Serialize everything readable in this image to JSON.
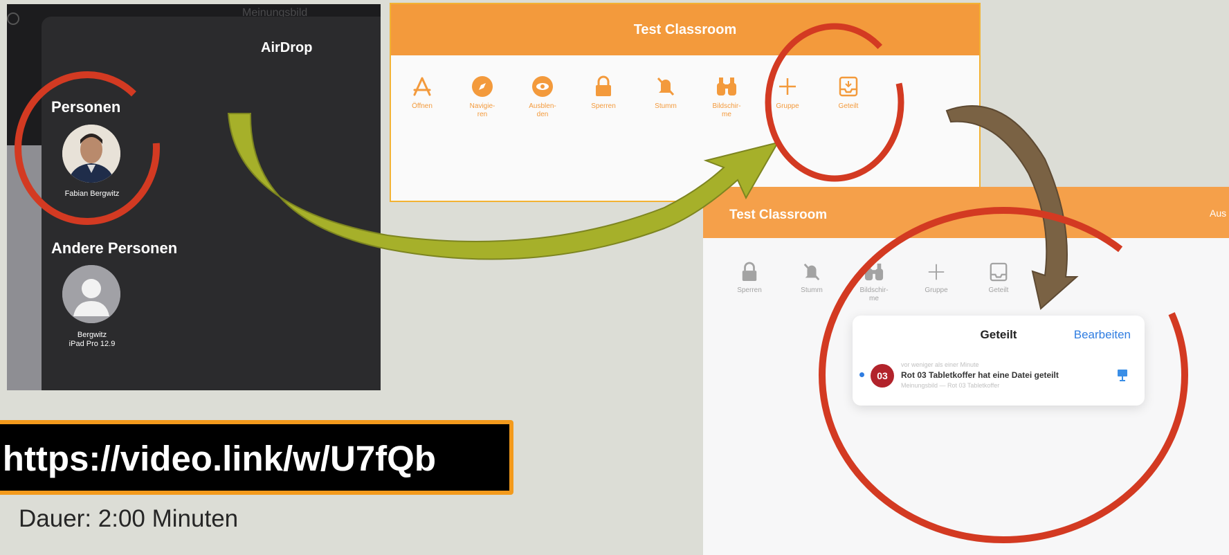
{
  "airdrop": {
    "top_title": "Meinungsbild",
    "title": "AirDrop",
    "section_people": "Personen",
    "person_name": "Fabian Bergwitz",
    "section_other": "Andere Personen",
    "device_name_line1": "Bergwitz",
    "device_name_line2": "iPad Pro 12.9"
  },
  "classroom_top": {
    "title": "Test Classroom",
    "toolbar": [
      {
        "label": "Öffnen",
        "icon": "app-store-icon"
      },
      {
        "label": "Navigie-\nren",
        "icon": "compass-icon"
      },
      {
        "label": "Ausblen-\nden",
        "icon": "eye-icon"
      },
      {
        "label": "Sperren",
        "icon": "lock-icon"
      },
      {
        "label": "Stumm",
        "icon": "mute-bell-icon"
      },
      {
        "label": "Bildschir-\nme",
        "icon": "binoculars-icon"
      },
      {
        "label": "Gruppe",
        "icon": "plus-icon"
      },
      {
        "label": "Geteilt",
        "icon": "tray-icon"
      }
    ]
  },
  "classroom_bottom": {
    "title": "Test Classroom",
    "right_label": "Aus",
    "toolbar": [
      {
        "label": "Sperren",
        "icon": "lock-icon"
      },
      {
        "label": "Stumm",
        "icon": "mute-bell-icon"
      },
      {
        "label": "Bildschir-\nme",
        "icon": "binoculars-icon"
      },
      {
        "label": "Gruppe",
        "icon": "plus-icon"
      },
      {
        "label": "Geteilt",
        "icon": "tray-icon"
      }
    ],
    "popover": {
      "title": "Geteilt",
      "edit": "Bearbeiten",
      "item": {
        "badge": "03",
        "meta": "vor weniger als einer Minute",
        "message": "Rot 03 Tabletkoffer hat eine Datei geteilt",
        "sub": "Meinungsbild — Rot 03 Tabletkoffer"
      }
    }
  },
  "banner": {
    "url": "https://video.link/w/U7fQb",
    "duration": "Dauer: 2:00 Minuten"
  },
  "colors": {
    "orange": "#f39a3c",
    "red_circle": "#d33a22",
    "olive_arrow": "#a6b02a",
    "brown_arrow": "#7a6244",
    "background": "#dcddd6"
  }
}
